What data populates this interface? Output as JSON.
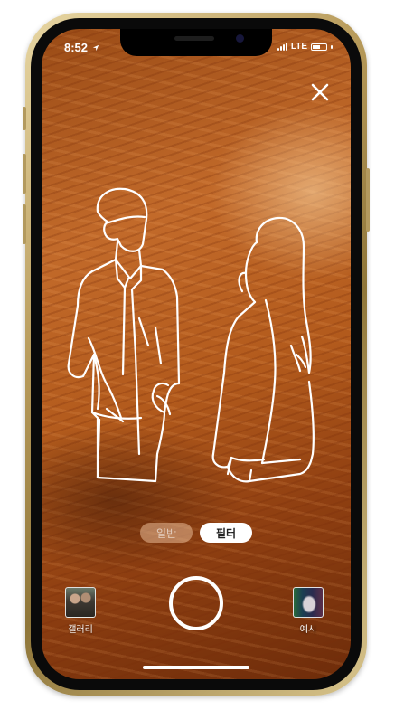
{
  "status": {
    "time": "8:52",
    "carrier": "LTE"
  },
  "controls": {
    "close_icon": "close-icon",
    "mode_normal": "일반",
    "mode_filter": "필터",
    "gallery_label": "갤러리",
    "example_label": "예시",
    "active_mode": "필터"
  },
  "theme": {
    "frame_gold": "#b79a5a",
    "screen_wood": "#b25a1c",
    "outline": "#ffffff"
  }
}
